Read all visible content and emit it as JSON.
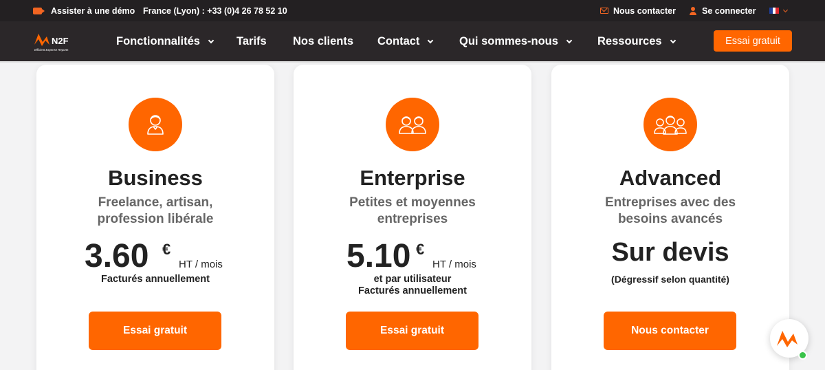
{
  "topbar": {
    "demo_label": "Assister à une démo",
    "phone_label": "France (Lyon) : +33 (0)4 26 78 52 10",
    "contact_label": "Nous contacter",
    "login_label": "Se connecter",
    "language_icon": "flag-fr-icon"
  },
  "nav": {
    "logo_text": "N2F",
    "logo_tagline": "Efficient Expense Reports",
    "items": [
      {
        "label": "Fonctionnalités",
        "dropdown": true
      },
      {
        "label": "Tarifs",
        "dropdown": false
      },
      {
        "label": "Nos clients",
        "dropdown": false
      },
      {
        "label": "Contact",
        "dropdown": true
      },
      {
        "label": "Qui sommes-nous",
        "dropdown": true
      },
      {
        "label": "Ressources",
        "dropdown": true
      }
    ],
    "cta_label": "Essai gratuit"
  },
  "plans": [
    {
      "icon": "single-user-icon",
      "title": "Business",
      "subtitle": [
        "Freelance, artisan,",
        "profession libérale"
      ],
      "price": "3.60",
      "currency": "€",
      "unit": "HT / mois",
      "notes": [
        "Facturés annuellement"
      ],
      "cta_label": "Essai gratuit"
    },
    {
      "icon": "two-users-icon",
      "title": "Enterprise",
      "subtitle": [
        "Petites et moyennes",
        "entreprises"
      ],
      "price": "5.10",
      "currency": "€",
      "unit": "HT / mois",
      "notes": [
        "et par utilisateur",
        "Facturés annuellement"
      ],
      "cta_label": "Essai gratuit"
    },
    {
      "icon": "three-users-icon",
      "title": "Advanced",
      "subtitle": [
        "Entreprises avec des",
        "besoins avancés"
      ],
      "price_text": "Sur devis",
      "notes": [
        "(Dégressif selon quantité)"
      ],
      "cta_label": "Nous contacter"
    }
  ],
  "colors": {
    "accent": "#ff6600",
    "topbar_bg": "#232022",
    "nav_bg": "#2b2729",
    "online": "#3ac34a"
  }
}
